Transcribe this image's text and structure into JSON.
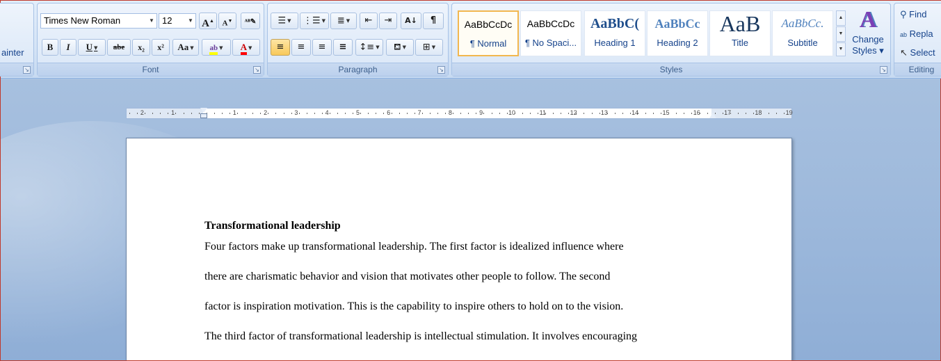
{
  "ribbon": {
    "clipboard": {
      "format_painter_label": "ainter"
    },
    "font": {
      "group_label": "Font",
      "font_name": "Times New Roman",
      "font_size": "12",
      "grow_label": "A",
      "shrink_label": "A",
      "bold_label": "B",
      "italic_label": "I",
      "underline_label": "U",
      "strike_label": "abe",
      "subscript_label": "x₂",
      "superscript_label": "x²",
      "case_label": "Aa",
      "highlight_label": "ab",
      "font_color_label": "A"
    },
    "paragraph": {
      "group_label": "Paragraph",
      "sort_label": "A↓",
      "pilcrow_label": "¶"
    },
    "styles": {
      "group_label": "Styles",
      "tiles": [
        {
          "preview": "AaBbCcDc",
          "name": "¶ Normal"
        },
        {
          "preview": "AaBbCcDc",
          "name": "¶ No Spaci..."
        },
        {
          "preview": "AaBbC(",
          "name": "Heading 1"
        },
        {
          "preview": "AaBbCc",
          "name": "Heading 2"
        },
        {
          "preview": "AaB",
          "name": "Title"
        },
        {
          "preview": "AaBbCc.",
          "name": "Subtitle"
        }
      ],
      "change_styles_line1": "Change",
      "change_styles_line2": "Styles ▾"
    },
    "editing": {
      "group_label": "Editing",
      "find_label": "Find",
      "replace_label": "Repla",
      "select_label": "Select"
    }
  },
  "ruler": {
    "left_ticks": [
      "2",
      "1"
    ],
    "right_ticks": [
      "1",
      "2",
      "3",
      "4",
      "5",
      "6",
      "7",
      "8",
      "9",
      "10",
      "11",
      "12",
      "13",
      "14",
      "15",
      "16",
      "17",
      "18",
      "19"
    ]
  },
  "document": {
    "heading": "Transformational leadership",
    "lines": [
      "Four factors make up transformational leadership. The first factor is idealized influence where",
      "there are charismatic behavior and vision that motivates other people to follow. The second",
      "factor is inspiration motivation. This is the capability to inspire others to hold on to the vision.",
      "The third factor of transformational leadership is intellectual stimulation. It involves encouraging"
    ]
  },
  "colors": {
    "highlight": "#ffff00",
    "font_color": "#ff0000",
    "selected_style_border": "#f2b74f",
    "ribbon_text": "#15428b"
  }
}
